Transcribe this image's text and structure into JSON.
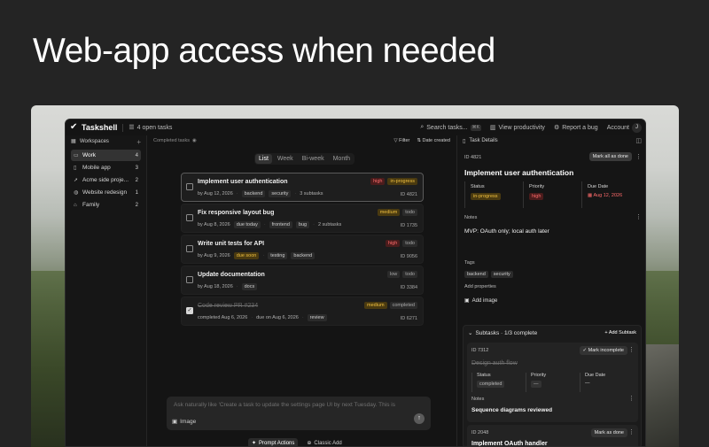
{
  "hero": {
    "title": "Web-app access when needed"
  },
  "topbar": {
    "app_name": "Taskshell",
    "open_tasks": "4 open tasks",
    "search": "Search tasks...",
    "search_kbd": "⌘K",
    "productivity": "View productivity",
    "report": "Report a bug",
    "account": "Account",
    "avatar": "J"
  },
  "sidebar": {
    "heading": "Workspaces",
    "items": [
      {
        "label": "Work",
        "count": "4"
      },
      {
        "label": "Mobile app",
        "count": "3"
      },
      {
        "label": "Acme side proje...",
        "count": "2"
      },
      {
        "label": "Website redesign",
        "count": "1"
      },
      {
        "label": "Family",
        "count": "2"
      }
    ]
  },
  "main": {
    "completed_tasks": "Completed tasks",
    "filter": "Filter",
    "sort": "Date created",
    "tabs": [
      "List",
      "Week",
      "Bi-week",
      "Month"
    ],
    "tasks": [
      {
        "title": "Implement user authentication",
        "due": "by Aug 12, 2026",
        "tags": [
          "backend",
          "security"
        ],
        "extra": "3 subtasks",
        "priority": "high",
        "status": "in-progress",
        "id": "ID 4821"
      },
      {
        "title": "Fix responsive layout bug",
        "due": "by Aug 8, 2026",
        "due_badge": "due today",
        "tags": [
          "frontend",
          "bug"
        ],
        "extra": "2 subtasks",
        "priority": "medium",
        "status": "todo",
        "id": "ID 1735"
      },
      {
        "title": "Write unit tests for API",
        "due": "by Aug 9, 2026",
        "due_badge": "due soon",
        "tags": [
          "testing",
          "backend"
        ],
        "priority": "high",
        "status": "todo",
        "id": "ID 9056"
      },
      {
        "title": "Update documentation",
        "due": "by Aug 18, 2026",
        "tags": [
          "docs"
        ],
        "priority": "low",
        "status": "todo",
        "id": "ID 3384"
      },
      {
        "title": "Code review PR #234",
        "completed": "completed Aug 6, 2026",
        "due": "due on Aug 6, 2026",
        "tags": [
          "review"
        ],
        "priority": "medium",
        "status": "completed",
        "id": "ID 6271"
      }
    ],
    "composer_placeholder": "Ask naturally like 'Create a task to update the settings page UI by next Tuesday. This is",
    "image_label": "Image",
    "modes": [
      "Prompt Actions",
      "Classic Add"
    ]
  },
  "details": {
    "heading": "Task Details",
    "id": "ID 4821",
    "mark_done": "Mark all as done",
    "title": "Implement user authentication",
    "status_label": "Status",
    "status_value": "in-progress",
    "priority_label": "Priority",
    "priority_value": "high",
    "due_label": "Due Date",
    "due_value": "Aug 12, 2026",
    "notes_label": "Notes",
    "notes_text": "MVP: OAuth only; local auth later",
    "tags_label": "Tags",
    "tags": [
      "backend",
      "security"
    ],
    "add_properties": "Add properties",
    "add_image": "Add image",
    "subtasks_heading": "Subtasks · 1/3 complete",
    "add_subtask": "Add Subtask",
    "sub1": {
      "id": "ID 7312",
      "mark": "Mark incomplete",
      "title": "Design auth flow",
      "status_label": "Status",
      "status_value": "completed",
      "priority_label": "Priority",
      "priority_value": "—",
      "due_label": "Due Date",
      "due_value": "—",
      "notes_label": "Notes",
      "notes_text": "Sequence diagrams reviewed"
    },
    "sub2": {
      "id": "ID 2048",
      "mark": "Mark as done",
      "title": "Implement OAuth handler"
    }
  }
}
